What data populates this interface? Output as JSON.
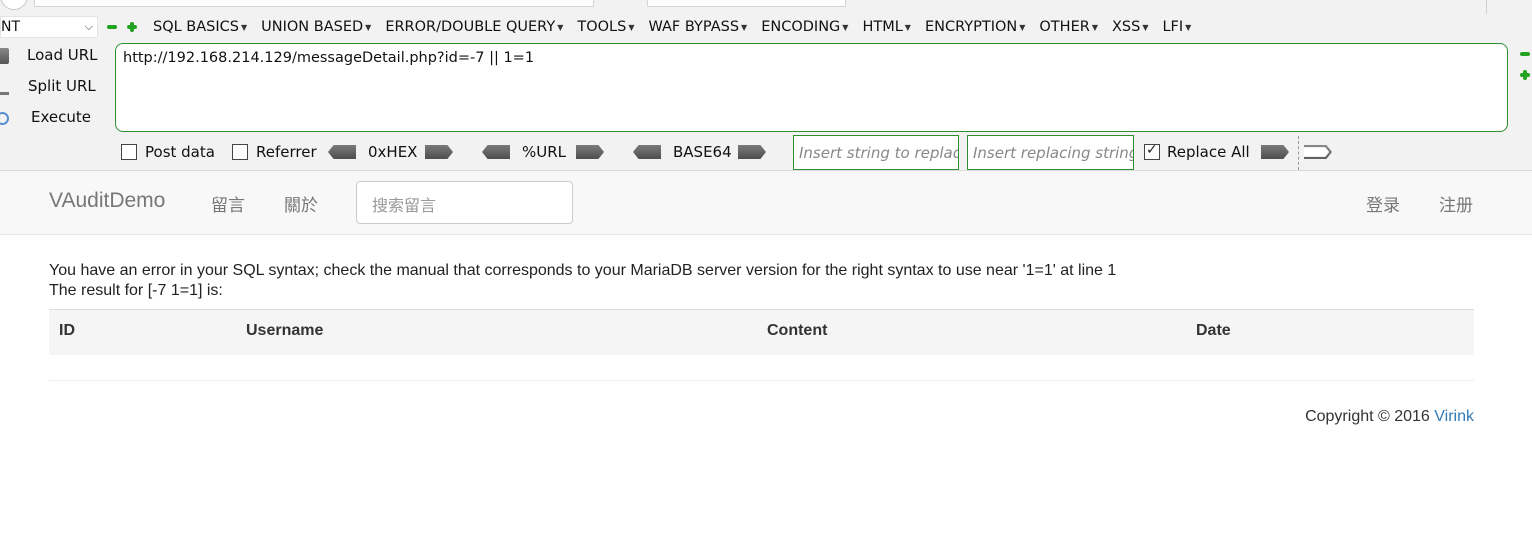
{
  "hackbar": {
    "mode_value": "NT",
    "menu": [
      {
        "label": "SQL BASICS"
      },
      {
        "label": "UNION BASED"
      },
      {
        "label": "ERROR/DOUBLE QUERY"
      },
      {
        "label": "TOOLS"
      },
      {
        "label": "WAF BYPASS"
      },
      {
        "label": "ENCODING"
      },
      {
        "label": "HTML"
      },
      {
        "label": "ENCRYPTION"
      },
      {
        "label": "OTHER"
      },
      {
        "label": "XSS"
      },
      {
        "label": "LFI"
      }
    ],
    "load_url": "Load URL",
    "split_url": "Split URL",
    "execute": "Execute",
    "url_value": "http://192.168.214.129/messageDetail.php?id=-7 || 1=1",
    "post_data": "Post data",
    "referrer": "Referrer",
    "hex": "0xHEX",
    "url_enc": "%URL",
    "base64": "BASE64",
    "replace_placeholder": "Insert string to replace",
    "replacing_placeholder": "Insert replacing string",
    "replace_all": "Replace All",
    "accent_color": "#2f8f2f"
  },
  "page": {
    "brand": "VAuditDemo",
    "nav": {
      "messages": "留言",
      "about": "關於"
    },
    "search_placeholder": "搜索留言",
    "login": "登录",
    "register": "注册",
    "error_text": "You have an error in your SQL syntax; check the manual that corresponds to your MariaDB server version for the right syntax to use near '1=1' at line 1",
    "result_text": "The result for [-7 1=1] is:",
    "table_headers": {
      "id": "ID",
      "username": "Username",
      "content": "Content",
      "date": "Date"
    },
    "copyright_prefix": "Copyright © 2016 ",
    "copyright_link": "Virink",
    "link_color": "#337ab7"
  }
}
